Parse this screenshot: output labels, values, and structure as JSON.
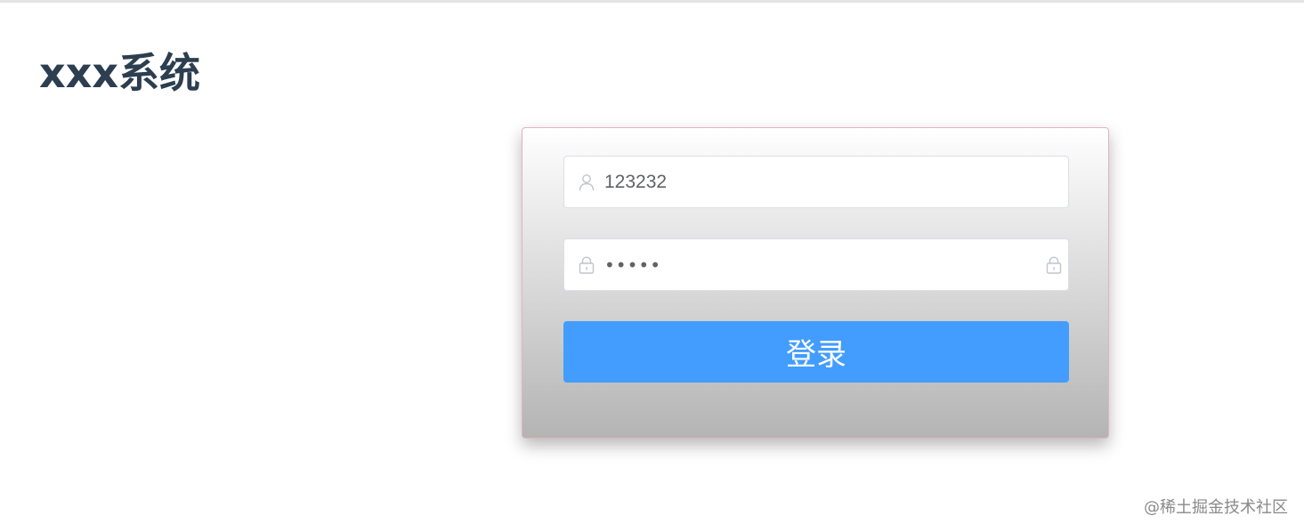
{
  "header": {
    "title": "xxx系统"
  },
  "login": {
    "username": {
      "value": "123232",
      "icon": "user-icon"
    },
    "password": {
      "masked_value": "•••••",
      "icon": "lock-icon",
      "suffix_icon": "lock-icon"
    },
    "submit_label": "登录"
  },
  "watermark": "@稀土掘金技术社区",
  "colors": {
    "title": "#2c3e50",
    "button": "#429dfe",
    "card_border": "#e6b3bf",
    "icon": "#c0c4cc"
  }
}
